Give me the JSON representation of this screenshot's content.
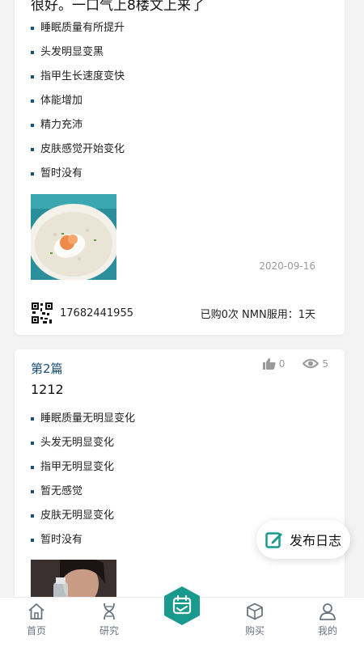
{
  "cards": [
    {
      "lead_text": "很好。一口气上8楼文上来了",
      "bullets": [
        "睡眠质量有所提升",
        "头发明显变黑",
        "指甲生长速度变快",
        "体能增加",
        "精力充沛",
        "皮肤感觉开始变化",
        "暂时没有"
      ],
      "date": "2020-09-16",
      "phone": "17682441955",
      "stats": "已购0次 NMN服用：1天"
    },
    {
      "article_title": "第2篇",
      "heading": "1212",
      "likes": "0",
      "views": "5",
      "bullets": [
        "睡眠质量无明显变化",
        "头发无明显变化",
        "指甲无明显变化",
        "暂无感觉",
        "皮肤无明显变化",
        "暂时没有"
      ]
    }
  ],
  "fab": {
    "label": "发布日志",
    "icon": "edit-icon"
  },
  "tabbar": {
    "tabs": [
      {
        "label": "首页",
        "icon": "home-icon"
      },
      {
        "label": "研究",
        "icon": "dna-icon"
      },
      {
        "label": "",
        "icon": "calendar-icon"
      },
      {
        "label": "购买",
        "icon": "box-icon"
      },
      {
        "label": "我的",
        "icon": "user-icon"
      }
    ]
  },
  "colors": {
    "accent": "#1a9a8f",
    "title_blue": "#1c4f7a"
  }
}
